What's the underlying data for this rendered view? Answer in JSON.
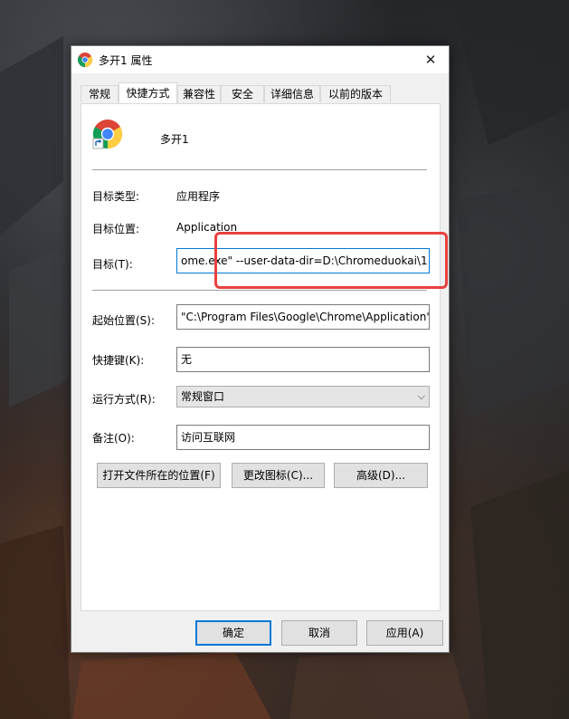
{
  "window": {
    "title": "多开1 属性",
    "close_glyph": "✕"
  },
  "tabs": [
    {
      "label": "常规"
    },
    {
      "label": "快捷方式"
    },
    {
      "label": "兼容性"
    },
    {
      "label": "安全"
    },
    {
      "label": "详细信息"
    },
    {
      "label": "以前的版本"
    }
  ],
  "active_tab": "快捷方式",
  "shortcut": {
    "name": "多开1",
    "icon": "chrome-icon",
    "target_type_label": "目标类型:",
    "target_type_value": "应用程序",
    "target_location_label": "目标位置:",
    "target_location_value": "Application",
    "target_label": "目标(T):",
    "target_value": "ome.exe\" --user-data-dir=D:\\Chromeduokai\\1",
    "start_in_label": "起始位置(S):",
    "start_in_value": "\"C:\\Program Files\\Google\\Chrome\\Application\"",
    "hotkey_label": "快捷键(K):",
    "hotkey_value": "无",
    "run_label": "运行方式(R):",
    "run_value": "常规窗口",
    "comment_label": "备注(O):",
    "comment_value": "访问互联网"
  },
  "actions": {
    "open_location": "打开文件所在的位置(F)",
    "change_icon": "更改图标(C)...",
    "advanced": "高级(D)..."
  },
  "footer": {
    "ok": "确定",
    "cancel": "取消",
    "apply": "应用(A)"
  },
  "colors": {
    "highlight": "#e8413e",
    "focus": "#0078d7"
  }
}
